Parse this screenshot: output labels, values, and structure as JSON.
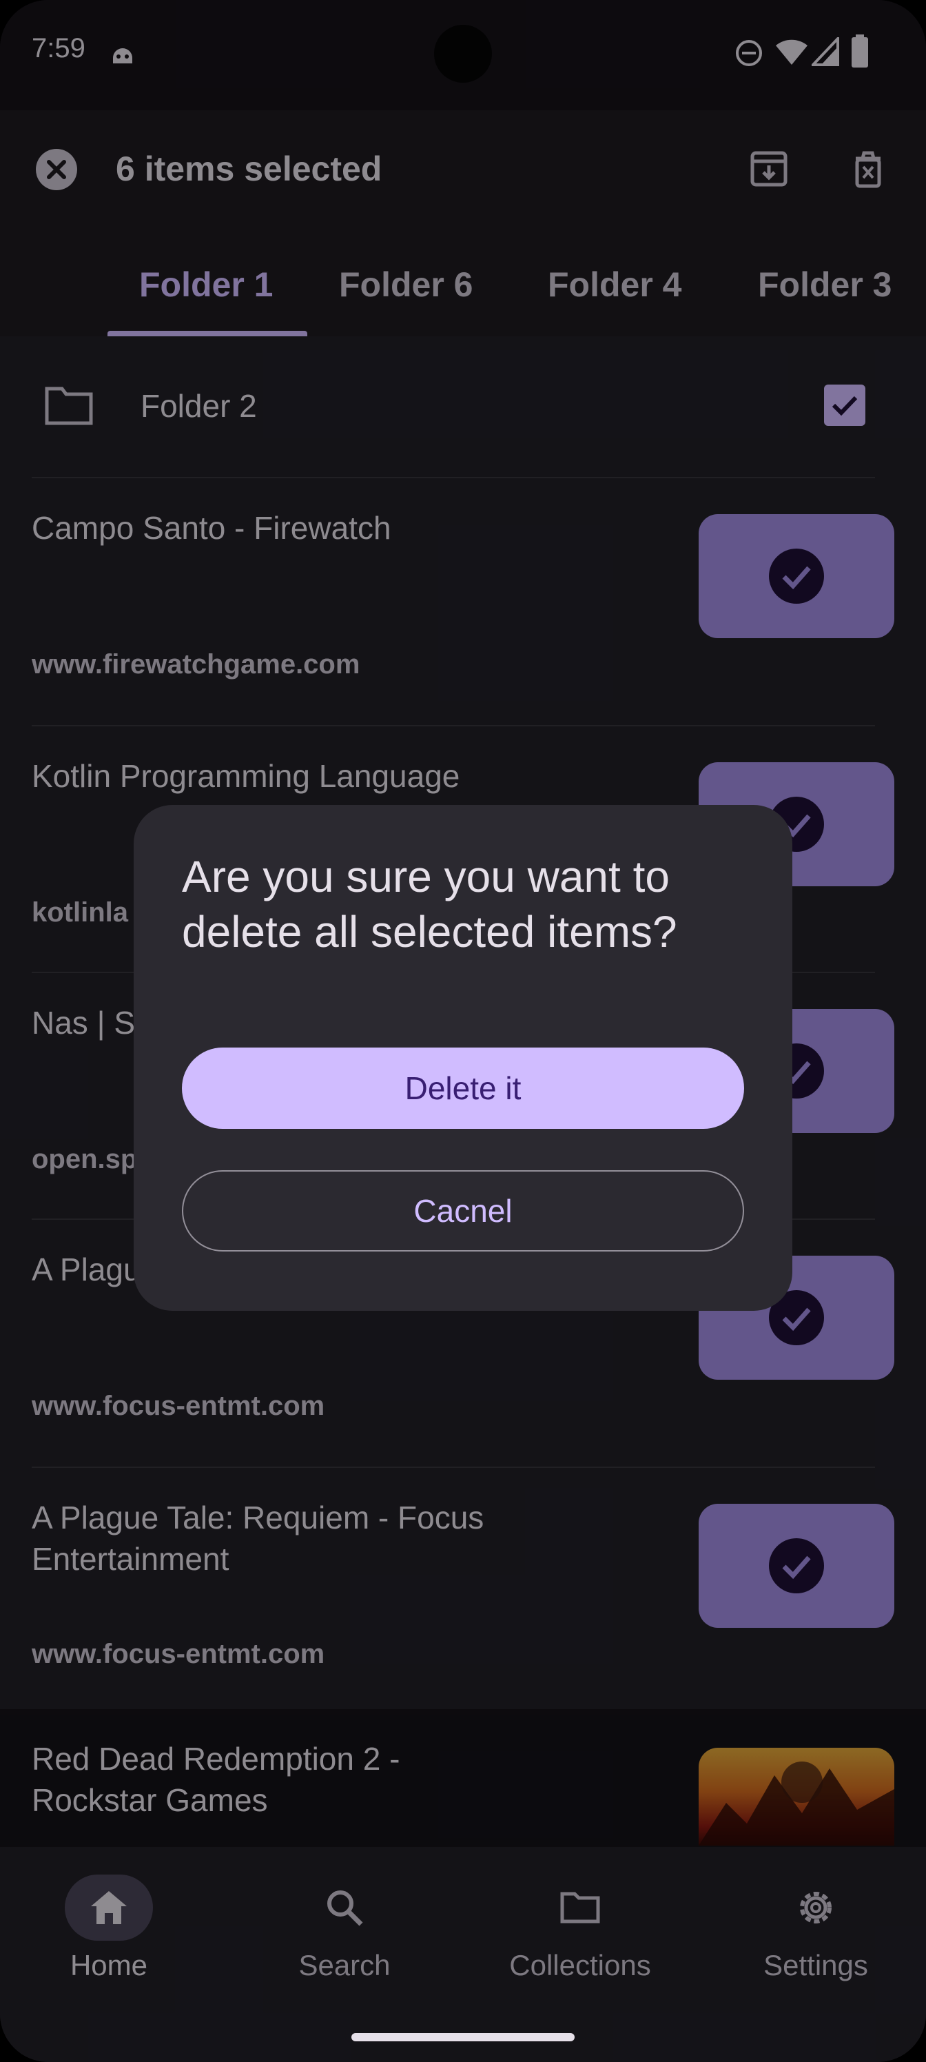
{
  "status_bar": {
    "time": "7:59",
    "icons": [
      "android-debug-icon",
      "do-not-disturb-icon",
      "wifi-icon",
      "signal-icon",
      "battery-icon"
    ]
  },
  "app_bar": {
    "title": "6 items selected",
    "actions": [
      "archive-icon",
      "delete-icon"
    ]
  },
  "tabs": [
    {
      "label": "Folder 1",
      "active": true
    },
    {
      "label": "Folder 6",
      "active": false
    },
    {
      "label": "Folder 4",
      "active": false
    },
    {
      "label": "Folder 3",
      "active": false
    }
  ],
  "folder_row": {
    "label": "Folder 2",
    "checked": true
  },
  "items": [
    {
      "title": "Campo Santo - Firewatch",
      "url": "www.firewatchgame.com",
      "selected": true
    },
    {
      "title": "Kotlin Programming Language",
      "url": "kotlinla",
      "selected": true
    },
    {
      "title": "Nas | S",
      "url": "open.sp",
      "selected": true
    },
    {
      "title": "A Plague Entertainment",
      "url": "www.focus-entmt.com",
      "selected": true
    },
    {
      "title": "A Plague Tale: Requiem - Focus Entertainment",
      "url": "www.focus-entmt.com",
      "selected": true
    }
  ],
  "plain_item": {
    "title": "Red Dead Redemption 2 - Rockstar Games"
  },
  "bottom_nav": [
    {
      "label": "Home",
      "icon": "home-icon",
      "active": true
    },
    {
      "label": "Search",
      "icon": "search-icon",
      "active": false
    },
    {
      "label": "Collections",
      "icon": "folder-icon",
      "active": false
    },
    {
      "label": "Settings",
      "icon": "gear-icon",
      "active": false
    }
  ],
  "dialog": {
    "title": "Are you sure you want to delete all selected items?",
    "confirm_label": "Delete it",
    "cancel_label": "Cacnel"
  },
  "colors": {
    "accent": "#d0bcff",
    "surface": "#211f26",
    "dialog_surface": "#2b2930",
    "on_surface": "#e6e0e9"
  }
}
